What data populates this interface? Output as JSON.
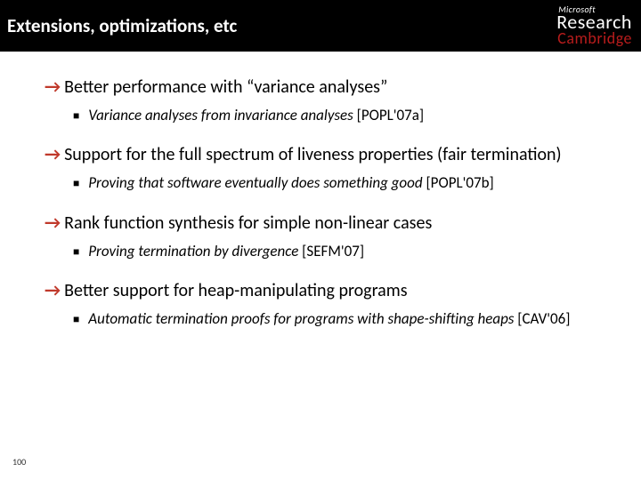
{
  "header": {
    "title": "Extensions, optimizations, etc",
    "logo": {
      "line1": "Microsoft",
      "line2": "Research",
      "line3": "Cambridge"
    }
  },
  "points": [
    {
      "main": "Better performance with “variance analyses”",
      "sub_italic": "Variance analyses from invariance analyses",
      "sub_ref": " [POPL'07a]"
    },
    {
      "main": "Support for the full spectrum of liveness properties (fair termination)",
      "sub_italic": "Proving that software eventually does something good",
      "sub_ref": " [POPL'07b]"
    },
    {
      "main": "Rank function synthesis for simple non-linear cases",
      "sub_italic": "Proving termination by divergence",
      "sub_ref": " [SEFM'07]"
    },
    {
      "main": "Better support for heap-manipulating programs",
      "sub_italic": "Automatic termination proofs for programs with shape-shifting heaps",
      "sub_ref": " [CAV'06]"
    }
  ],
  "page_number": "100"
}
